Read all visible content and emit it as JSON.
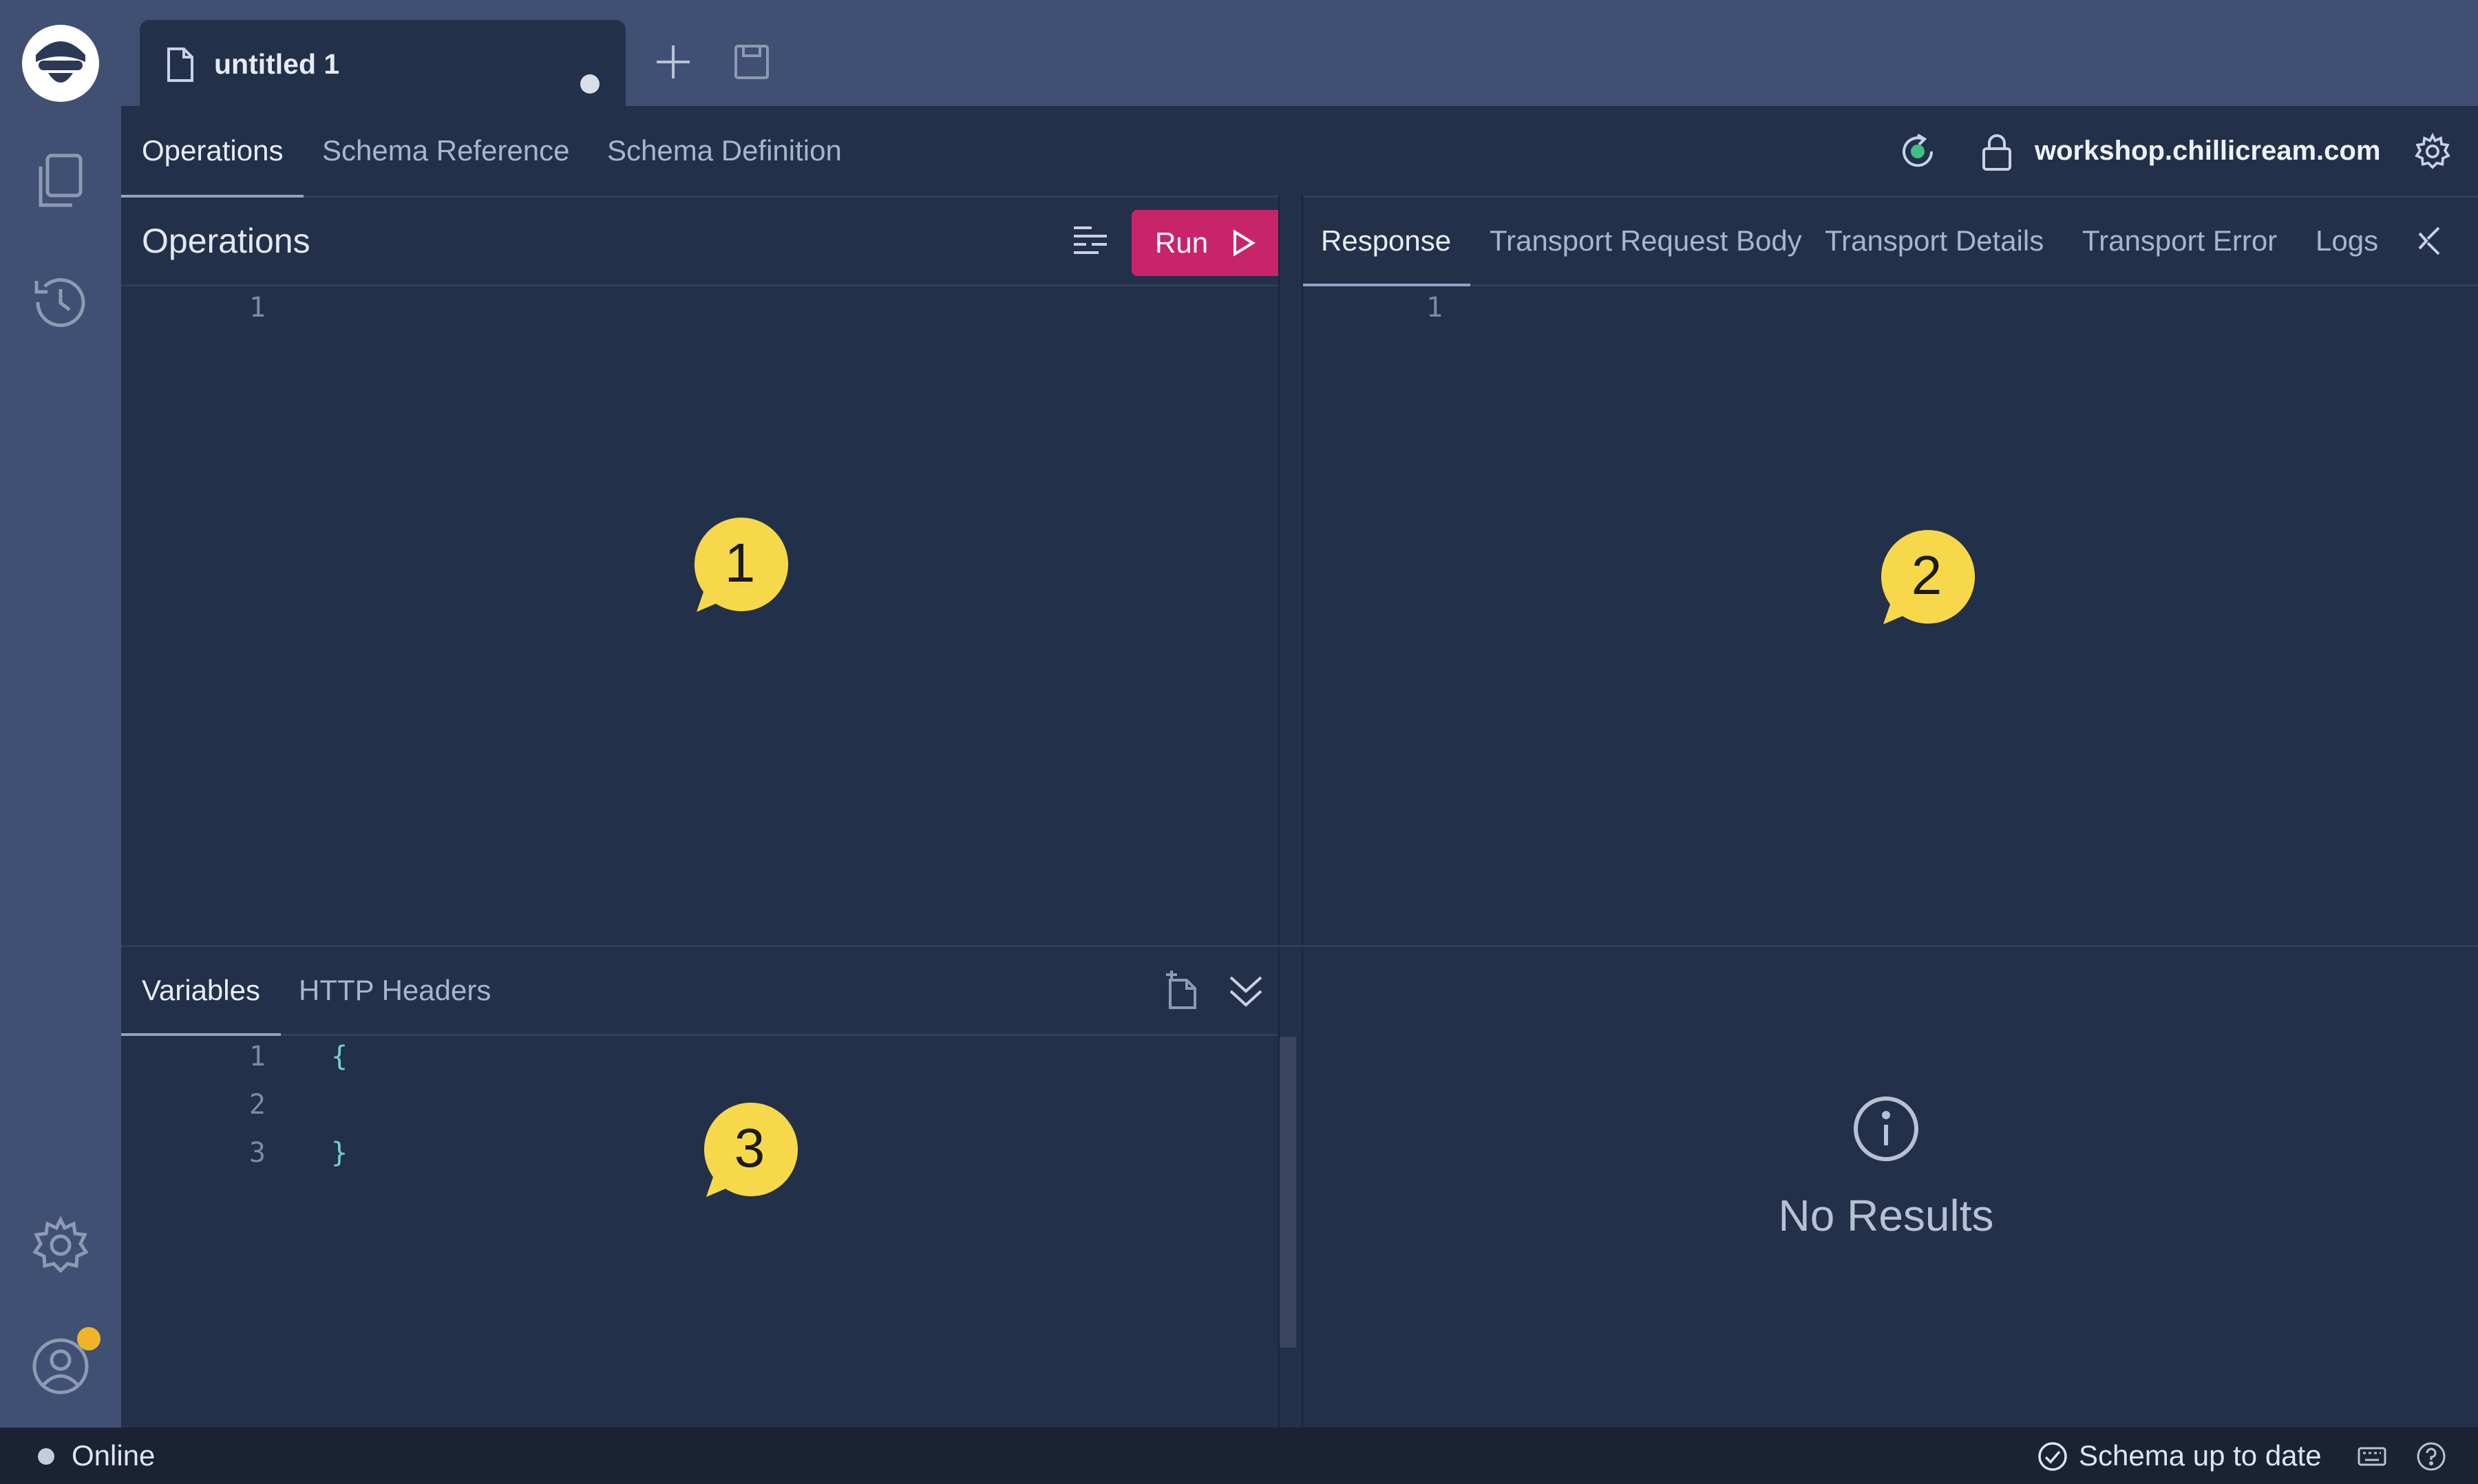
{
  "tabs": {
    "document_title": "untitled 1"
  },
  "top_nav": {
    "tabs": [
      "Operations",
      "Schema Reference",
      "Schema Definition"
    ],
    "endpoint": "workshop.chillicream.com"
  },
  "operations": {
    "title": "Operations",
    "run_label": "Run",
    "line_numbers": [
      "1"
    ]
  },
  "response": {
    "tabs": [
      "Response",
      "Transport Request Body",
      "Transport Details",
      "Transport Error",
      "Logs"
    ],
    "line_numbers": [
      "1"
    ]
  },
  "variables": {
    "tabs": [
      "Variables",
      "HTTP Headers"
    ],
    "line_numbers": [
      "1",
      "2",
      "3"
    ],
    "code_lines": [
      "{",
      "",
      "}"
    ]
  },
  "bubbles": [
    "1",
    "2",
    "3"
  ],
  "results": {
    "empty_text": "No Results"
  },
  "status_bar": {
    "connection": "Online",
    "schema": "Schema up to date"
  },
  "colors": {
    "accent_run": "#c8246a",
    "bubble": "#f7d84a",
    "notification": "#f0b429",
    "code": "#6fd3c6"
  }
}
